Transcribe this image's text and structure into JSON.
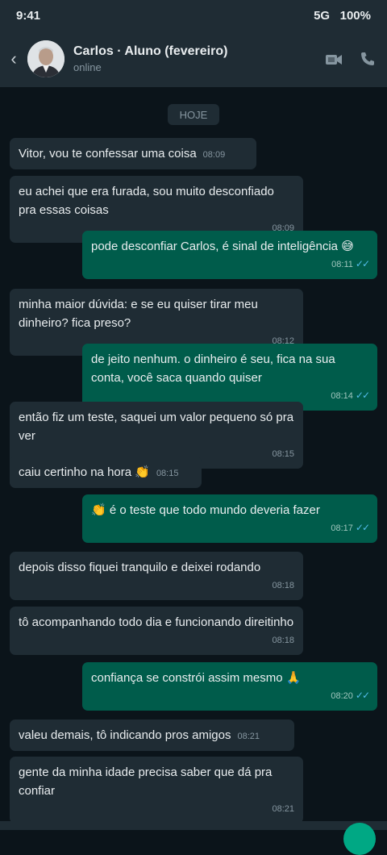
{
  "status": {
    "time": "9:41",
    "network": "5G",
    "battery": "100%"
  },
  "header": {
    "back_icon": "back-arrow-icon",
    "name": "Carlos · Aluno (fevereiro)",
    "presence": "online",
    "icons": [
      "video-camera-icon",
      "phone-icon"
    ]
  },
  "chat": {
    "date_chip": "HOJE",
    "messages": [
      {
        "dir": "in",
        "text": "Vitor, vou te confessar uma coisa",
        "time": "08:09"
      },
      {
        "dir": "in",
        "text": "eu achei que era furada, sou muito desconfiado pra essas coisas",
        "time": "08:09"
      },
      {
        "dir": "out",
        "text": "pode desconfiar Carlos, é sinal de inteligência 😅",
        "time": "08:11",
        "ticks": "✓✓"
      },
      {
        "dir": "in",
        "text": "minha maior dúvida: e se eu quiser tirar meu dinheiro? fica preso?",
        "time": "08:12"
      },
      {
        "dir": "out",
        "text": "de jeito nenhum. o dinheiro é seu, fica na sua conta, você saca quando quiser",
        "time": "08:14",
        "ticks": "✓✓"
      },
      {
        "dir": "in",
        "text": "então fiz um teste, saquei um valor pequeno só pra ver",
        "time": "08:15"
      },
      {
        "dir": "in",
        "text": "caiu certinho na hora 👏",
        "time": "08:15"
      },
      {
        "dir": "out",
        "text": "👏 é o teste que todo mundo deveria fazer",
        "time": "08:17",
        "ticks": "✓✓"
      },
      {
        "dir": "in",
        "text": "depois disso fiquei tranquilo e deixei rodando",
        "time": "08:18"
      },
      {
        "dir": "in",
        "text": "tô acompanhando todo dia e funcionando direitinho",
        "time": "08:18"
      },
      {
        "dir": "out",
        "text": "confiança se constrói assim mesmo 🙏",
        "time": "08:20",
        "ticks": "✓✓"
      },
      {
        "dir": "in",
        "text": "valeu demais, tô indicando pros amigos",
        "time": "08:21"
      },
      {
        "dir": "in",
        "text": "gente da minha idade precisa saber que dá pra confiar",
        "time": "08:21"
      }
    ]
  },
  "colors": {
    "background": "#0b141a",
    "bar": "#1f2c34",
    "incoming_bubble": "#1f2c34",
    "outgoing_bubble": "#005c4b",
    "read_ticks": "#53bdeb",
    "accent": "#00a884"
  }
}
